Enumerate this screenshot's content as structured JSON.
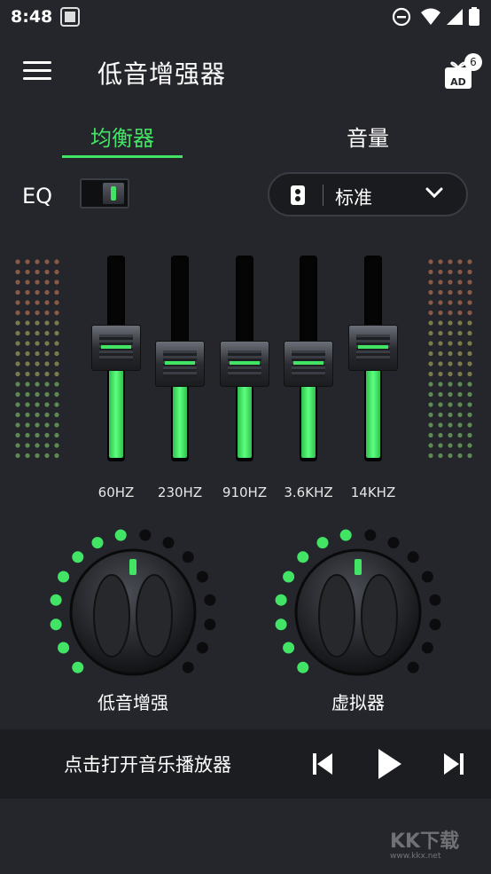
{
  "status_bar": {
    "time": "8:48"
  },
  "app_bar": {
    "title": "低音增强器",
    "ad_badge": "6",
    "ad_label": "AD"
  },
  "tabs": [
    {
      "label": "均衡器",
      "selected": true
    },
    {
      "label": "音量",
      "selected": false
    }
  ],
  "eq": {
    "label": "EQ",
    "enabled": true,
    "preset": "标准"
  },
  "bands": [
    {
      "label": "60HZ",
      "level": 0.62
    },
    {
      "label": "230HZ",
      "level": 0.52
    },
    {
      "label": "910HZ",
      "level": 0.52
    },
    {
      "label": "3.6KHZ",
      "level": 0.52
    },
    {
      "label": "14KHZ",
      "level": 0.62
    }
  ],
  "knobs": [
    {
      "label": "低音增强",
      "lit_dots": 8,
      "total_dots": 16
    },
    {
      "label": "虚拟器",
      "lit_dots": 8,
      "total_dots": 16
    }
  ],
  "player": {
    "text": "点击打开音乐播放器"
  },
  "watermark": {
    "text": "KK下载",
    "url": "www.kkx.net"
  },
  "colors": {
    "accent": "#42e466",
    "background": "#24262b",
    "player_bg": "#1c1d21"
  }
}
